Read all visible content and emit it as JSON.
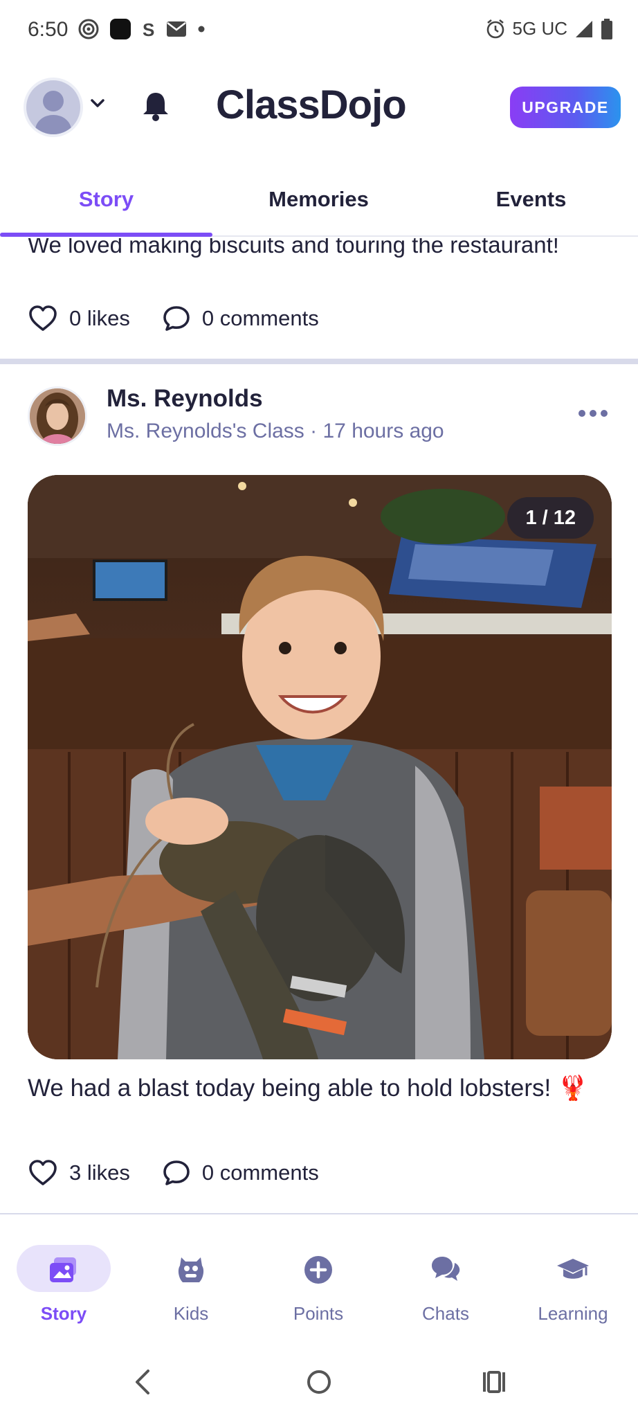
{
  "status_bar": {
    "time": "6:50",
    "network": "5G UC"
  },
  "header": {
    "brand": "ClassDojo",
    "upgrade_label": "UPGRADE"
  },
  "tabs": [
    {
      "label": "Story",
      "active": true
    },
    {
      "label": "Memories",
      "active": false
    },
    {
      "label": "Events",
      "active": false
    }
  ],
  "previous_post": {
    "caption": "We loved making biscuits and touring the restaurant!",
    "likes": "0 likes",
    "comments": "0 comments"
  },
  "post": {
    "author": "Ms. Reynolds",
    "class_name": "Ms. Reynolds's Class",
    "time_ago": "17 hours ago",
    "photo_counter": "1 / 12",
    "caption": "We had a blast today being able to hold lobsters! 🦞",
    "likes": "3 likes",
    "comments": "0 comments"
  },
  "bottom_nav": [
    {
      "label": "Story",
      "icon": "story-photos-icon",
      "active": true
    },
    {
      "label": "Kids",
      "icon": "monster-icon",
      "active": false
    },
    {
      "label": "Points",
      "icon": "plus-circle-icon",
      "active": false
    },
    {
      "label": "Chats",
      "icon": "chat-bubbles-icon",
      "active": false
    },
    {
      "label": "Learning",
      "icon": "graduation-cap-icon",
      "active": false
    }
  ],
  "colors": {
    "accent": "#7c4df6",
    "muted": "#6c6fa3",
    "text": "#22223a",
    "divider": "#d8daea"
  }
}
